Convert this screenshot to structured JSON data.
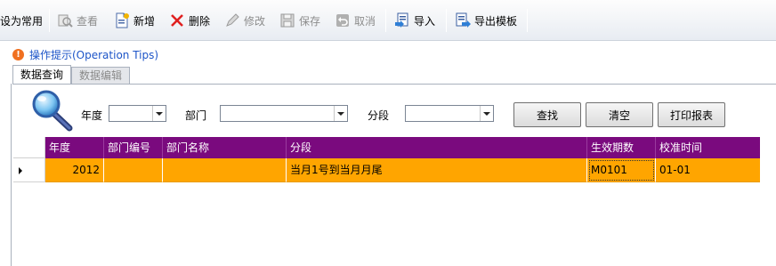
{
  "toolbar": {
    "set_common": "设为常用",
    "view": "查看",
    "add": "新增",
    "delete": "删除",
    "edit": "修改",
    "save": "保存",
    "cancel": "取消",
    "import": "导入",
    "export_template": "导出模板"
  },
  "tips": {
    "text": "操作提示(Operation Tips)"
  },
  "tabs": {
    "query": "数据查询",
    "edit": "数据编辑"
  },
  "search": {
    "year_label": "年度",
    "dept_label": "部门",
    "segment_label": "分段",
    "year_value": "",
    "dept_value": "",
    "segment_value": "",
    "find_btn": "查找",
    "clear_btn": "清空",
    "print_btn": "打印报表"
  },
  "grid": {
    "columns": [
      "年度",
      "部门编号",
      "部门名称",
      "分段",
      "生效期数",
      "校准时间"
    ],
    "rows": [
      {
        "year": "2012",
        "dept_code": "",
        "dept_name": "",
        "segment": "当月1号到当月月尾",
        "period": "M0101",
        "calib": "01-01"
      }
    ]
  },
  "colors": {
    "header_bg": "#7a0a7e",
    "row_selected": "#ffa500",
    "tips_link": "#1d55c8",
    "delete_icon": "#e02020"
  }
}
